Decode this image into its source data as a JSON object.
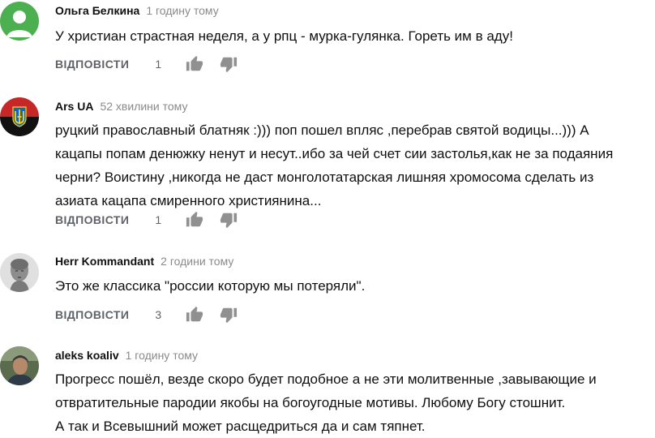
{
  "comments": [
    {
      "author": "Ольга Белкина",
      "time": "1 годину тому",
      "text": "У христиан страстная неделя, а у рпц - мурка-гулянка. Гореть им в аду!",
      "reply_label": "ВІДПОВІСТИ",
      "likes": "1",
      "avatar": "default-user-avatar"
    },
    {
      "author": "Ars UA",
      "time": "52 хвилини тому",
      "text": "руцкий православный блатняк :))) поп пошел впляс ,перебрав святой водицы...))) А\nкацапы попам денюжку ненут и несут..ибо за чей счет сии застолья,как не за подаяния\nчерни? Воистину ,никогда не даст монголотатарская лишняя хромосома сделать из\nазиата кацапа смиренного християнина...",
      "reply_label": "ВІДПОВІСТИ",
      "likes": "1",
      "avatar": "trident-flag-avatar"
    },
    {
      "author": "Herr Kommandant",
      "time": "2 години тому",
      "text": "Это же классика \"россии которую мы потеряли\".",
      "reply_label": "ВІДПОВІСТИ",
      "likes": "3",
      "avatar": "bust-statue-avatar"
    },
    {
      "author": "aleks koaliv",
      "time": "1 годину тому",
      "text": "Прогресс пошёл, везде скоро будет подобное а не эти молитвенные ,завывающие и\nотвратительные пародии якобы на богоугодные мотивы. Любому Богу стошнит.\nА так и Всевышний может расщедриться да и сам тяпнет.",
      "avatar": "photo-avatar"
    }
  ],
  "icons": {
    "like": "thumbs-up-icon",
    "dislike": "thumbs-down-icon"
  },
  "colors": {
    "meta": "#8a8a8a",
    "action": "#5f6368",
    "default_avatar": "#4caf50"
  }
}
